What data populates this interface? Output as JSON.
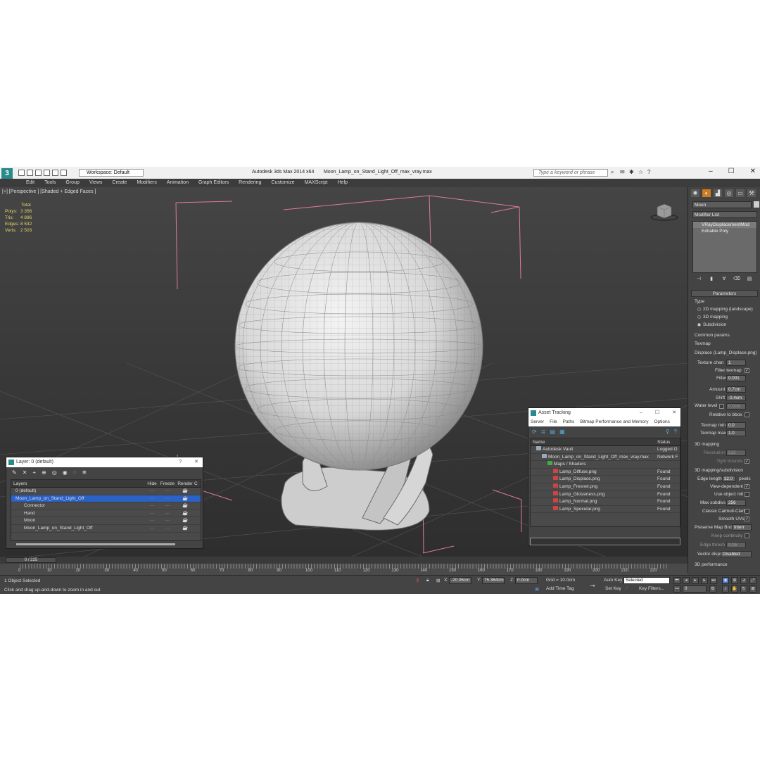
{
  "titlebar": {
    "app_title": "Autodesk 3ds Max  2014 x64",
    "file_name": "Moon_Lamp_on_Stand_Light_Off_max_vray.max",
    "workspace": "Workspace: Default",
    "search_placeholder": "Type a keyword or phrase",
    "minimize": "–",
    "maximize": "☐",
    "close": "✕"
  },
  "menu": [
    "Edit",
    "Tools",
    "Group",
    "Views",
    "Create",
    "Modifiers",
    "Animation",
    "Graph Editors",
    "Rendering",
    "Customize",
    "MAXScript",
    "Help"
  ],
  "viewport": {
    "label": "[+] [Perspective ] [Shaded + Edged Faces ]",
    "stats_header": "Total",
    "stats": [
      {
        "k": "Polys:",
        "v": "3 356"
      },
      {
        "k": "Tris:",
        "v": "4 896"
      },
      {
        "k": "Edges:",
        "v": "8 532"
      },
      {
        "k": "Verts:",
        "v": "2 503"
      }
    ]
  },
  "command_panel": {
    "object_name": "Moon",
    "modifier_list": "Modifier List",
    "stack": [
      "VRayDisplacementMod",
      "Editable Poly"
    ],
    "parameters_header": "Parameters",
    "type_label": "Type",
    "type_options": [
      "2D mapping (landscape)",
      "3D mapping",
      "Subdivision"
    ],
    "common_params": "Common params",
    "texmap_label": "Texmap",
    "texmap_value": "Displace (Lamp_Displace.png)",
    "texture_chan_label": "Texture chan",
    "texture_chan": "1",
    "filter_texmap": "Filter texmap",
    "filter_blur_label": "Filter blur",
    "filter_blur": "0.001",
    "amount_label": "Amount",
    "amount": "0.7cm",
    "shift_label": "Shift",
    "shift": "-0.4cm",
    "water_level_label": "Water level",
    "water_level": "0.0cm",
    "relative_to_bbox": "Relative to bbox",
    "texmap_min_label": "Texmap min",
    "texmap_min": "0.0",
    "texmap_max_label": "Texmap max",
    "texmap_max": "1.0",
    "mapping_3d": "3D mapping",
    "resolution_label": "Resolution",
    "resolution": "512",
    "tight_bounds": "Tight bounds",
    "mapping_subdiv": "3D mapping/subdivision",
    "edge_length_label": "Edge length",
    "edge_length": "32.0",
    "pixels": "pixels",
    "view_dependent": "View-dependent",
    "use_object_mtl": "Use object mtl",
    "max_subdivs_label": "Max subdivs",
    "max_subdivs": "256",
    "classic_catmull": "Classic Catmull-Clark",
    "smooth_uvs": "Smooth UVs",
    "preserve_map_bnd": "Preserve Map Bnd",
    "preserve_map_val": "Interr",
    "keep_continuity": "Keep continuity",
    "edge_thresh_label": "Edge thresh",
    "edge_thresh": "0.05",
    "vector_displ_label": "Vector displ",
    "vector_displ": "Disabled",
    "performance": "3D performance"
  },
  "layer_dialog": {
    "title": "Layer: 0 (default)",
    "col_layers": "Layers",
    "col_hide": "Hide",
    "col_freeze": "Freeze",
    "col_render": "Render",
    "col_c": "C",
    "rows": [
      {
        "name": "0 (default)",
        "indent": 0,
        "selected": false
      },
      {
        "name": "Moon_Lamp_on_Stand_Light_Off",
        "indent": 0,
        "selected": true
      },
      {
        "name": "Connector",
        "indent": 1,
        "selected": false
      },
      {
        "name": "Hand",
        "indent": 1,
        "selected": false
      },
      {
        "name": "Moon",
        "indent": 1,
        "selected": false
      },
      {
        "name": "Moon_Lamp_on_Stand_Light_Off",
        "indent": 1,
        "selected": false
      }
    ]
  },
  "asset_dialog": {
    "title": "Asset Tracking",
    "menu": [
      "Server",
      "File",
      "Paths",
      "Bitmap Performance and Memory",
      "Options"
    ],
    "col_name": "Name",
    "col_status": "Status",
    "rows": [
      {
        "name": "Autodesk Vault",
        "status": "Logged O",
        "indent": 1
      },
      {
        "name": "Moon_Lamp_on_Stand_Light_Off_max_vray.max",
        "status": "Network F",
        "indent": 2
      },
      {
        "name": "Maps / Shaders",
        "status": "",
        "indent": 3
      },
      {
        "name": "Lamp_Diffuse.png",
        "status": "Found",
        "indent": 4
      },
      {
        "name": "Lamp_Displace.png",
        "status": "Found",
        "indent": 4
      },
      {
        "name": "Lamp_Fresnel.png",
        "status": "Found",
        "indent": 4
      },
      {
        "name": "Lamp_Glossiness.png",
        "status": "Found",
        "indent": 4
      },
      {
        "name": "Lamp_Normal.png",
        "status": "Found",
        "indent": 4
      },
      {
        "name": "Lamp_Specular.png",
        "status": "Found",
        "indent": 4
      }
    ]
  },
  "timeline": {
    "frame": "0 / 225",
    "ticks": [
      "0",
      "10",
      "20",
      "30",
      "40",
      "50",
      "60",
      "70",
      "80",
      "90",
      "100",
      "110",
      "120",
      "130",
      "140",
      "150",
      "160",
      "170",
      "180",
      "190",
      "200",
      "210",
      "220"
    ]
  },
  "status": {
    "selection": "1 Object Selected",
    "prompt": "Click and drag up-and-down to zoom in and out",
    "x_label": "X:",
    "x": "-20.06cm",
    "y_label": "Y:",
    "y": "75.364cm",
    "z_label": "Z:",
    "z": "0.0cm",
    "grid": "Grid = 10.0cm",
    "add_time_tag": "Add Time Tag",
    "auto_key": "Auto Key",
    "set_key": "Set Key",
    "selected": "Selected",
    "key_filters": "Key Filters...",
    "frame_field": "0"
  }
}
